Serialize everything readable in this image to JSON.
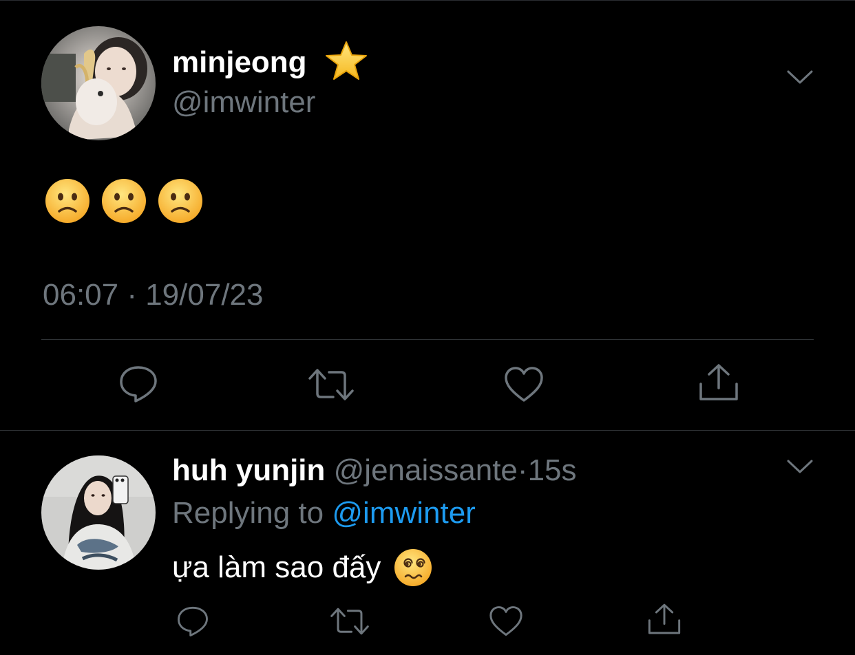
{
  "main_tweet": {
    "display_name": "minjeong",
    "name_badge_icon": "star-emoji",
    "handle": "@imwinter",
    "text_emojis": [
      "slightly-frowning-face",
      "slightly-frowning-face",
      "slightly-frowning-face"
    ],
    "timestamp": "06:07 · 19/07/23",
    "menu_icon": "chevron-down-icon",
    "actions": [
      "reply-icon",
      "retweet-icon",
      "like-icon",
      "share-icon"
    ]
  },
  "reply_tweet": {
    "display_name": "huh yunjin",
    "handle": "@jenaissante",
    "separator": "·",
    "time_ago": "15s",
    "replying_prefix": "Replying to",
    "replying_mention": "@imwinter",
    "text": "ựa làm sao đấy",
    "text_emoji": "face-with-spiral-eyes",
    "menu_icon": "chevron-down-icon",
    "actions": [
      "reply-icon",
      "retweet-icon",
      "like-icon",
      "share-icon"
    ]
  },
  "colors": {
    "background": "#000000",
    "primary_text": "#ffffff",
    "secondary_text": "#6e767d",
    "link": "#1d9bf0",
    "divider": "#2f3336",
    "icon": "#6e767d"
  }
}
